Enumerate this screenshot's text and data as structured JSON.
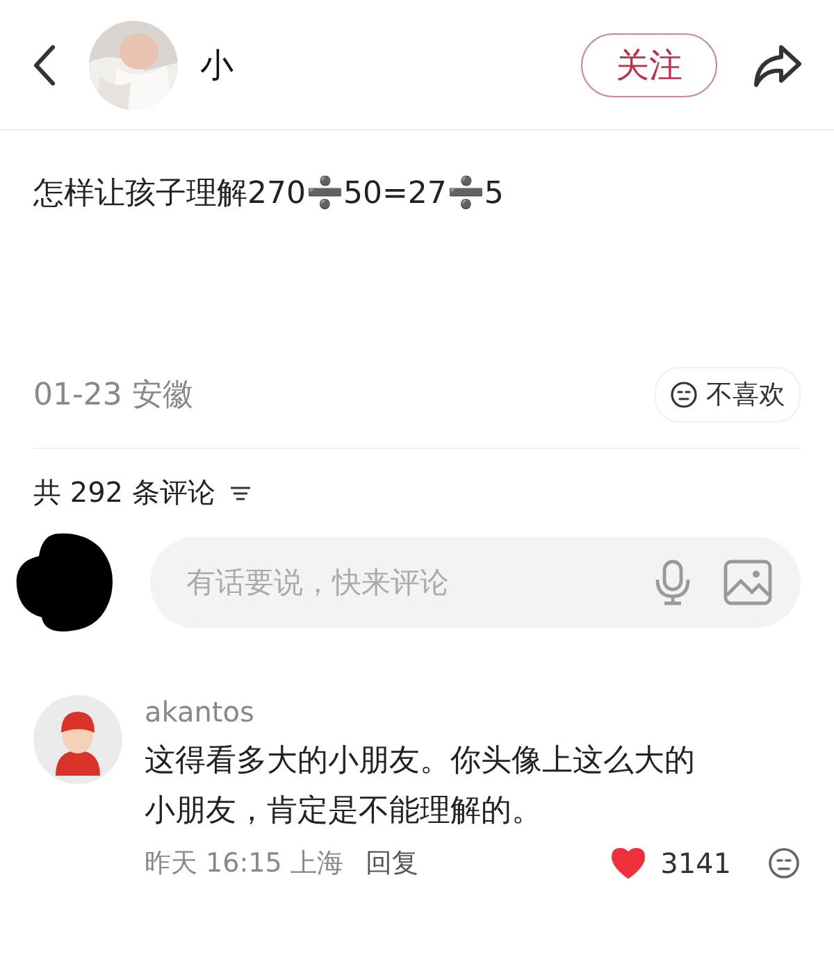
{
  "header": {
    "author": "小",
    "follow_label": "关注"
  },
  "post": {
    "title": "怎样让孩子理解270➗50=27➗5",
    "meta": "01-23 安徽",
    "dislike_label": "不喜欢"
  },
  "comments_header": {
    "count_label": "共 292 条评论"
  },
  "comment_input": {
    "placeholder": "有话要说，快来评论"
  },
  "comments": [
    {
      "user": "akantos",
      "text": "这得看多大的小朋友。你头像上这么大的小朋友，肯定是不能理解的。",
      "time": "昨天 16:15 上海",
      "reply_label": "回复",
      "likes": "3141",
      "liked": true
    }
  ]
}
